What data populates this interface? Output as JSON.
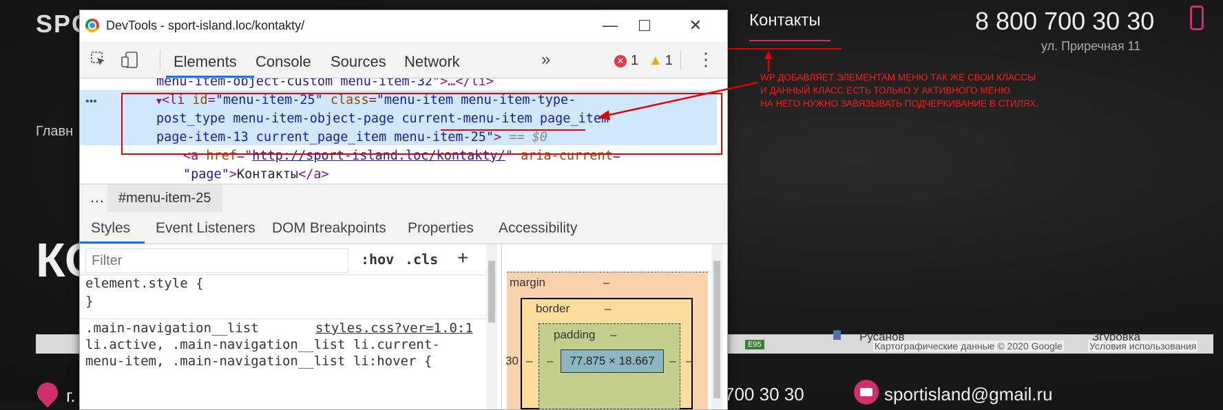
{
  "background_site": {
    "logo_fragment": "SPO",
    "nav_active": "Контакты",
    "phone": "8 800 700 30 30",
    "address": "ул. Приречная 11",
    "left_fragment": "Главн",
    "heading_fragment": "КС",
    "map": {
      "place_1": "Русанов",
      "place_2": "Згуровка",
      "road_label": "E95",
      "credits": "Картографические данные © 2020 Google",
      "terms": "Условия использования"
    },
    "footer": {
      "city_fragment": "г.",
      "phone_fragment": "700 30 30",
      "email": "sportisland@gmail.ru"
    },
    "accent_color": "#d02f6f"
  },
  "devtools": {
    "window_title": "DevTools - sport-island.loc/kontakty/",
    "main_tabs": [
      "Elements",
      "Console",
      "Sources",
      "Network"
    ],
    "active_tab": "Elements",
    "more_tabs": "»",
    "error_count": "1",
    "warning_count": "1",
    "dom": {
      "line0_val": "menu-item-object-custom menu-item-32",
      "line0_tail": "\">…</li>",
      "selected_tag_open": "<li ",
      "selected_id_attr": "id",
      "selected_id_val": "\"menu-item-25\"",
      "selected_class_attr": "class",
      "selected_class_part1": "\"menu-item menu-item-type-",
      "selected_class_part2": "post_type menu-item-object-page current-menu-item page_item",
      "selected_class_part3": "page-item-13 current_page_item menu-item-25\"",
      "selected_close": ">",
      "selected_marker": " == $0",
      "anchor_open": "<a ",
      "anchor_href_attr": "href",
      "anchor_href_val": "http://sport-island.loc/kontakty/",
      "anchor_aria_attr": "aria-current",
      "anchor_aria_val": "\"page\"",
      "anchor_text": "Контакты",
      "anchor_close": "</a>"
    },
    "breadcrumb": "#menu-item-25",
    "sub_tabs": [
      "Styles",
      "Event Listeners",
      "DOM Breakpoints",
      "Properties",
      "Accessibility"
    ],
    "active_sub_tab": "Styles",
    "styles": {
      "filter_placeholder": "Filter",
      "hov": ":hov",
      "cls": ".cls",
      "add": "+",
      "element_style_open": "element.style {",
      "element_style_close": "}",
      "rule_selector_1": ".main-navigation__list",
      "rule_source": "styles.css?ver=1.0:1",
      "rule_selector_2": "li.active, .main-navigation__list li.current-",
      "rule_selector_3": "menu-item, .main-navigation__list li:hover {"
    },
    "box_model": {
      "margin_label": "margin",
      "margin_value": "–",
      "border_label": "border",
      "border_value": "–",
      "padding_label": "padding",
      "padding_value": "–",
      "content_size": "77.875 × 18.667",
      "left_outer": "30",
      "side_dash": "–"
    }
  },
  "annotation": {
    "text": "WP ДОБАВЛЯЕТ ЭЛЕМЕНТАМ МЕНЮ ТАК ЖЕ СВОИ КЛАССЫ\nИ ДАННЫЙ КЛАСС ЕСТЬ ТОЛЬКО У АКТИВНОГО МЕНЮ\nНА НЕГО НУЖНО ЗАВЯЗЫВАТЬ ПОДЧЕРКИВАНИЕ В СТИЛЯХ.",
    "color": "#e00000"
  }
}
